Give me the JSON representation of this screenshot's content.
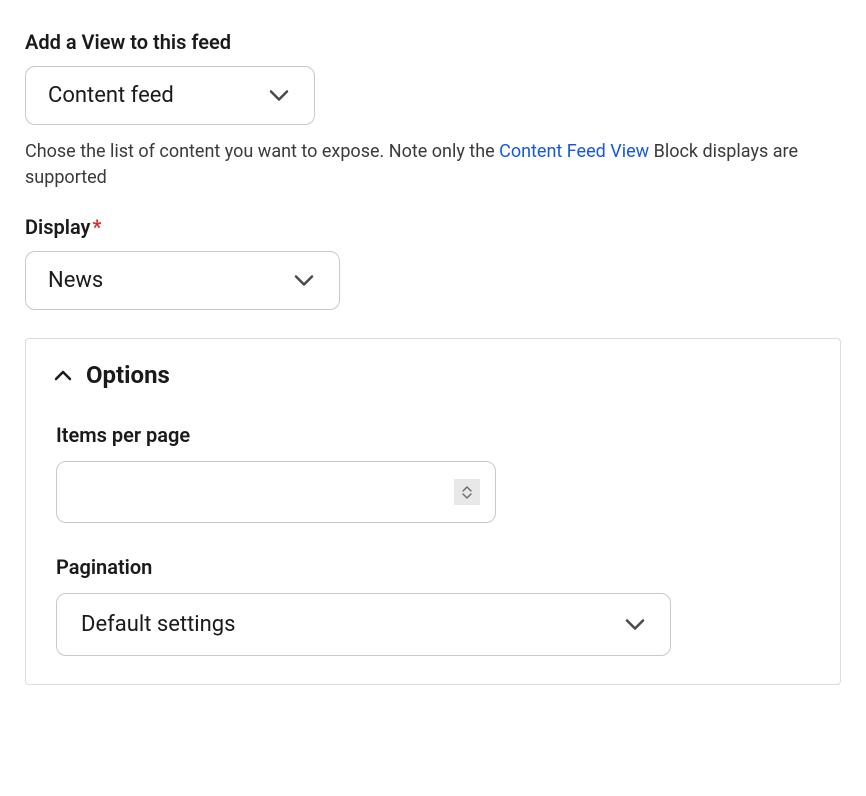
{
  "viewField": {
    "label": "Add a View to this feed",
    "value": "Content feed",
    "helpPrefix": "Chose the list of content you want to expose. Note only the ",
    "helpLink": "Content Feed View",
    "helpSuffix": " Block displays are supported"
  },
  "displayField": {
    "label": "Display",
    "required": "*",
    "value": "News"
  },
  "options": {
    "title": "Options",
    "itemsPerPage": {
      "label": "Items per page",
      "value": ""
    },
    "pagination": {
      "label": "Pagination",
      "value": "Default settings"
    }
  }
}
